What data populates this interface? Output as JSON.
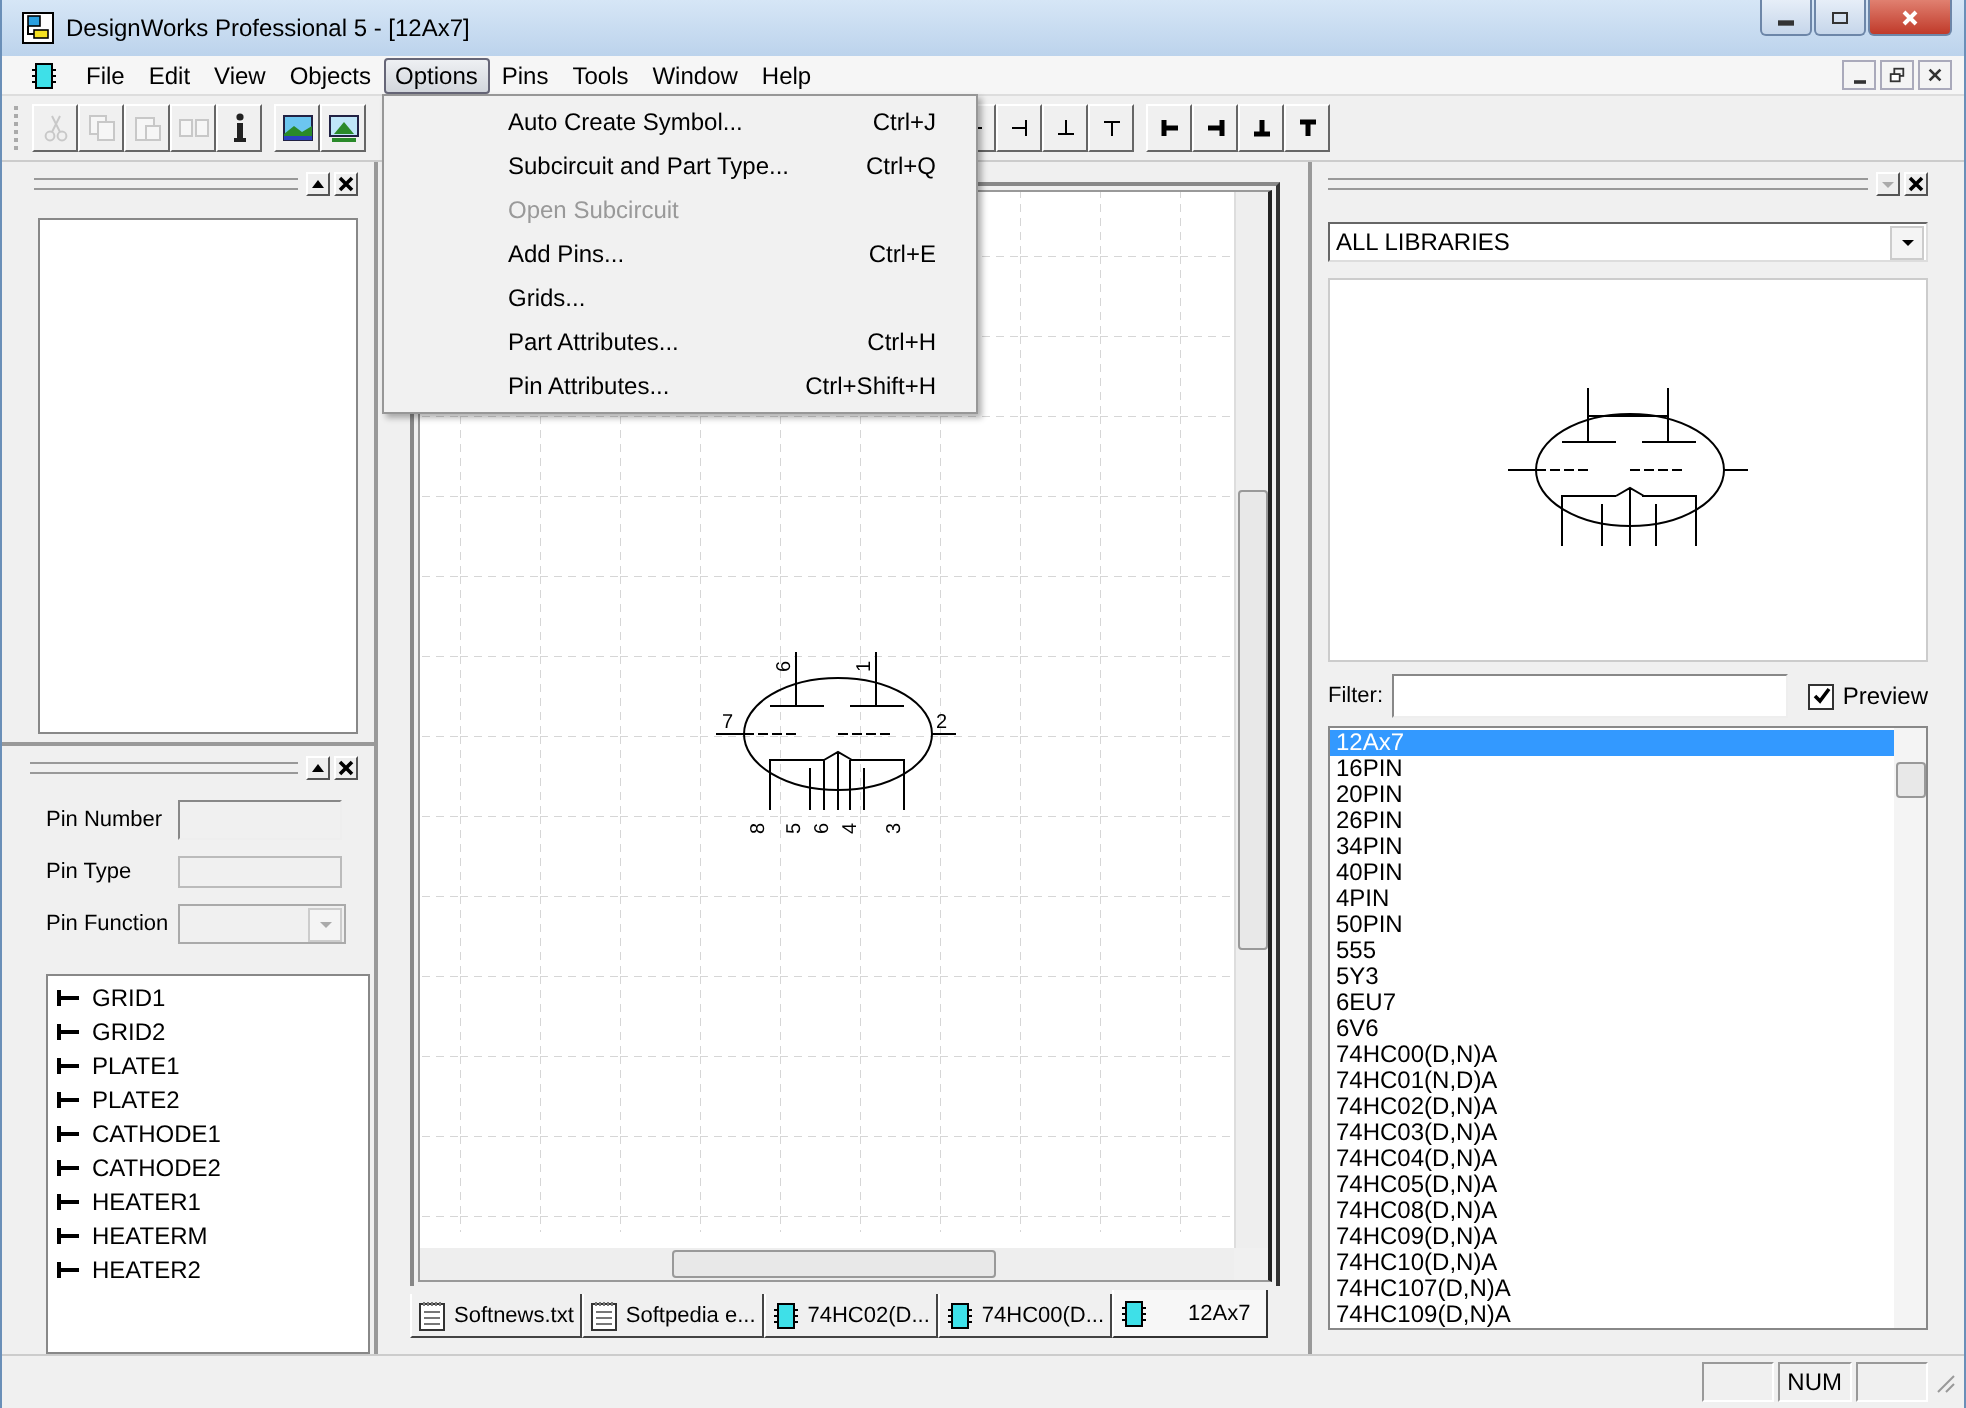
{
  "window": {
    "title": "DesignWorks Professional 5 - [12Ax7]"
  },
  "menu": [
    {
      "label": "File",
      "selected": false
    },
    {
      "label": "Edit",
      "selected": false
    },
    {
      "label": "View",
      "selected": false
    },
    {
      "label": "Objects",
      "selected": false
    },
    {
      "label": "Options",
      "selected": true
    },
    {
      "label": "Pins",
      "selected": false
    },
    {
      "label": "Tools",
      "selected": false
    },
    {
      "label": "Window",
      "selected": false
    },
    {
      "label": "Help",
      "selected": false
    }
  ],
  "open_menu": [
    {
      "label": "Auto Create Symbol...",
      "shortcut": "Ctrl+J",
      "disabled": false
    },
    {
      "label": "Subcircuit and Part Type...",
      "shortcut": "Ctrl+Q",
      "disabled": false
    },
    {
      "label": "Open Subcircuit",
      "disabled": true
    },
    {
      "label": "Add Pins...",
      "shortcut": "Ctrl+E",
      "disabled": false
    },
    {
      "label": "Grids...",
      "disabled": false
    },
    {
      "label": "Part Attributes...",
      "shortcut": "Ctrl+H",
      "disabled": false
    },
    {
      "label": "Pin Attributes...",
      "shortcut": "Ctrl+Shift+H",
      "disabled": false
    }
  ],
  "toolbar": [
    {
      "kind": "cut",
      "disabled": true
    },
    {
      "kind": "copy",
      "disabled": true
    },
    {
      "kind": "paste",
      "disabled": true
    },
    {
      "kind": "duplicate",
      "disabled": true
    },
    {
      "kind": "info",
      "disabled": false
    },
    {
      "kind": "gap"
    },
    {
      "kind": "picture",
      "disabled": false
    },
    {
      "kind": "picture2",
      "disabled": false
    },
    {
      "kind": "hidden"
    },
    {
      "kind": "pin-left"
    },
    {
      "kind": "pin-right"
    },
    {
      "kind": "pin-down"
    },
    {
      "kind": "pin-up"
    },
    {
      "kind": "gap"
    },
    {
      "kind": "pin-left-bold"
    },
    {
      "kind": "pin-right-bold"
    },
    {
      "kind": "pin-down-bold"
    },
    {
      "kind": "pin-up-bold"
    }
  ],
  "pin_properties": {
    "fields": [
      {
        "label": "Pin Number",
        "kind": "text"
      },
      {
        "label": "Pin Type",
        "kind": "readonly"
      },
      {
        "label": "Pin Function",
        "kind": "select"
      }
    ],
    "pins": [
      "GRID1",
      "GRID2",
      "PLATE1",
      "PLATE2",
      "CATHODE1",
      "CATHODE2",
      "HEATER1",
      "HEATERM",
      "HEATER2"
    ]
  },
  "canvas": {
    "pin_numbers": [
      "6",
      "1",
      "7",
      "2",
      "8",
      "5",
      "6",
      "4",
      "3"
    ]
  },
  "documents": [
    {
      "label": "Softnews.txt",
      "kind": "text",
      "selected": false
    },
    {
      "label": "Softpedia e...",
      "kind": "text",
      "selected": false
    },
    {
      "label": "74HC02(D...",
      "kind": "part",
      "selected": false
    },
    {
      "label": "74HC00(D...",
      "kind": "part",
      "selected": false
    },
    {
      "label": "12Ax7",
      "kind": "part",
      "selected": true
    }
  ],
  "library": {
    "dropdown": "ALL LIBRARIES",
    "filter_label": "Filter:",
    "preview": {
      "label": "Preview",
      "checked": true
    },
    "parts": [
      {
        "name": "12Ax7",
        "selected": true
      },
      {
        "name": "16PIN",
        "selected": false
      },
      {
        "name": "20PIN",
        "selected": false
      },
      {
        "name": "26PIN",
        "selected": false
      },
      {
        "name": "34PIN",
        "selected": false
      },
      {
        "name": "40PIN",
        "selected": false
      },
      {
        "name": "4PIN",
        "selected": false
      },
      {
        "name": "50PIN",
        "selected": false
      },
      {
        "name": "555",
        "selected": false
      },
      {
        "name": "5Y3",
        "selected": false
      },
      {
        "name": "6EU7",
        "selected": false
      },
      {
        "name": "6V6",
        "selected": false
      },
      {
        "name": "74HC00(D,N)A",
        "selected": false
      },
      {
        "name": "74HC01(N,D)A",
        "selected": false
      },
      {
        "name": "74HC02(D,N)A",
        "selected": false
      },
      {
        "name": "74HC03(D,N)A",
        "selected": false
      },
      {
        "name": "74HC04(D,N)A",
        "selected": false
      },
      {
        "name": "74HC05(D,N)A",
        "selected": false
      },
      {
        "name": "74HC08(D,N)A",
        "selected": false
      },
      {
        "name": "74HC09(D,N)A",
        "selected": false
      },
      {
        "name": "74HC10(D,N)A",
        "selected": false
      },
      {
        "name": "74HC107(D,N)A",
        "selected": false
      },
      {
        "name": "74HC109(D,N)A",
        "selected": false
      }
    ]
  },
  "status_bar": {
    "indicator": "NUM"
  }
}
